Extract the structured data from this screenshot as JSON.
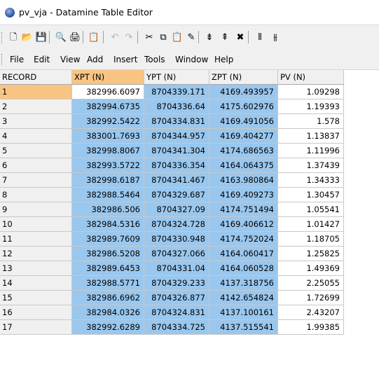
{
  "window": {
    "title": "pv_vja - Datamine Table Editor",
    "icon": "datamine-app-icon"
  },
  "toolbar": {
    "buttons": [
      {
        "name": "new-icon",
        "glyph": "🗋"
      },
      {
        "name": "open-folder-icon",
        "glyph": "📂"
      },
      {
        "name": "save-icon",
        "glyph": "💾"
      },
      {
        "name": "print-preview-icon",
        "glyph": "🔍"
      },
      {
        "name": "print-icon",
        "glyph": "🖨"
      },
      {
        "name": "properties-icon",
        "glyph": "📋"
      },
      {
        "name": "undo-icon",
        "glyph": "↶"
      },
      {
        "name": "redo-icon",
        "glyph": "↷"
      },
      {
        "name": "cut-icon",
        "glyph": "✂"
      },
      {
        "name": "copy-icon",
        "glyph": "⧉"
      },
      {
        "name": "paste-icon",
        "glyph": "📋"
      },
      {
        "name": "edit-icon",
        "glyph": "✎"
      },
      {
        "name": "insert-row-icon",
        "glyph": "⇟"
      },
      {
        "name": "insert-row-after-icon",
        "glyph": "⇞"
      },
      {
        "name": "delete-row-icon",
        "glyph": "✖"
      },
      {
        "name": "insert-column-icon",
        "glyph": "⫴"
      },
      {
        "name": "insert-column-after-icon",
        "glyph": "⫵"
      }
    ]
  },
  "menu": {
    "items": [
      "File",
      "Edit",
      "View",
      "Add",
      "Insert",
      "Tools",
      "Window",
      "Help"
    ]
  },
  "table": {
    "columns": [
      "RECORD",
      "XPT (N)",
      "YPT (N)",
      "ZPT (N)",
      "PV (N)"
    ],
    "active_column": 1,
    "active_record": 0,
    "rows": [
      [
        "1",
        "382996.6097",
        "8704339.171",
        "4169.493957",
        "1.09298"
      ],
      [
        "2",
        "382994.6735",
        "8704336.64",
        "4175.602976",
        "1.19393"
      ],
      [
        "3",
        "382992.5422",
        "8704334.831",
        "4169.491056",
        "1.578"
      ],
      [
        "4",
        "383001.7693",
        "8704344.957",
        "4169.404277",
        "1.13837"
      ],
      [
        "5",
        "382998.8067",
        "8704341.304",
        "4174.686563",
        "1.11996"
      ],
      [
        "6",
        "382993.5722",
        "8704336.354",
        "4164.064375",
        "1.37439"
      ],
      [
        "7",
        "382998.6187",
        "8704341.467",
        "4163.980864",
        "1.34333"
      ],
      [
        "8",
        "382988.5464",
        "8704329.687",
        "4169.409273",
        "1.30457"
      ],
      [
        "9",
        "382986.506",
        "8704327.09",
        "4174.751494",
        "1.05541"
      ],
      [
        "10",
        "382984.5316",
        "8704324.728",
        "4169.406612",
        "1.01427"
      ],
      [
        "11",
        "382989.7609",
        "8704330.948",
        "4174.752024",
        "1.18705"
      ],
      [
        "12",
        "382986.5208",
        "8704327.066",
        "4164.060417",
        "1.25825"
      ],
      [
        "13",
        "382989.6453",
        "8704331.04",
        "4164.060528",
        "1.49369"
      ],
      [
        "14",
        "382988.5771",
        "8704329.233",
        "4137.318756",
        "2.25055"
      ],
      [
        "15",
        "382986.6962",
        "8704326.877",
        "4142.654824",
        "1.72699"
      ],
      [
        "16",
        "382984.0326",
        "8704324.831",
        "4137.100161",
        "2.43207"
      ],
      [
        "17",
        "382992.6289",
        "8704334.725",
        "4137.515541",
        "1.99385"
      ]
    ]
  }
}
